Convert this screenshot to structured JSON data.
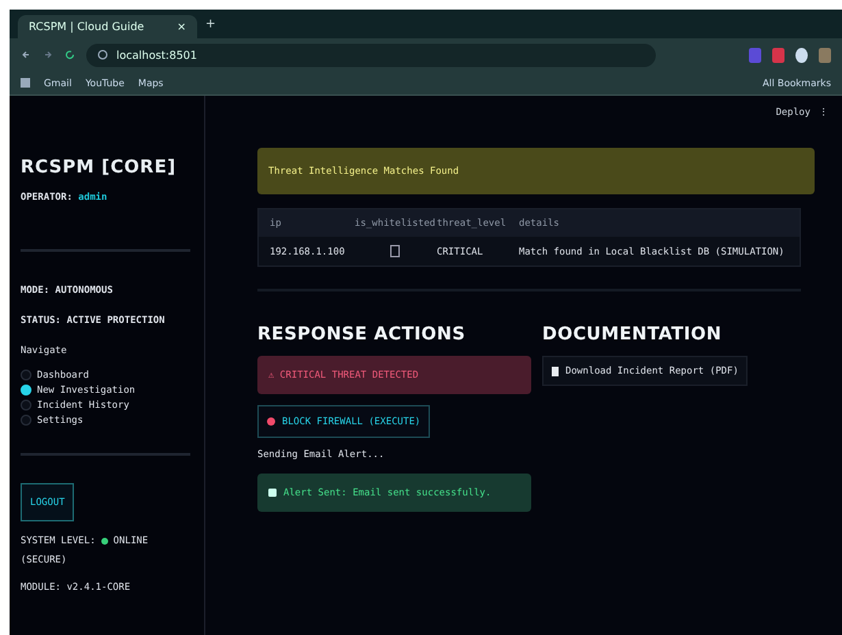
{
  "browser": {
    "tab_title": "RCSPM | Cloud Guide",
    "tab_close": "×",
    "new_tab": "+",
    "url": "localhost:8501",
    "bookmarks": [
      {
        "label": "Gmail"
      },
      {
        "label": "YouTube"
      },
      {
        "label": "Maps"
      }
    ],
    "all_bookmarks": "All Bookmarks"
  },
  "header": {
    "deploy": "Deploy",
    "menu": "⋮"
  },
  "sidebar": {
    "title": "RCSPM [CORE]",
    "operator_label": "OPERATOR:",
    "operator": "admin",
    "mode": "MODE: AUTONOMOUS",
    "status": "STATUS: ACTIVE PROTECTION",
    "nav_label": "Navigate",
    "nav_items": [
      {
        "label": "Dashboard",
        "selected": false
      },
      {
        "label": "New Investigation",
        "selected": true
      },
      {
        "label": "Incident History",
        "selected": false
      },
      {
        "label": "Settings",
        "selected": false
      }
    ],
    "logout": "LOGOUT",
    "system_label": "SYSTEM LEVEL:",
    "system_state": "ONLINE",
    "system_note": "(SECURE)",
    "module": "MODULE: v2.4.1-CORE"
  },
  "alert": "Threat Intelligence Matches Found",
  "table": {
    "columns": [
      "ip",
      "is_whitelisted",
      "threat_level",
      "details"
    ],
    "rows": [
      {
        "ip": "192.168.1.100",
        "is_whitelisted": false,
        "threat_level": "CRITICAL",
        "details": "Match found in Local Blacklist DB (SIMULATION)"
      }
    ]
  },
  "response": {
    "title": "RESPONSE ACTIONS",
    "threat": "⚠ CRITICAL THREAT DETECTED",
    "block": "BLOCK FIREWALL (EXECUTE)",
    "sending": "Sending Email Alert...",
    "sent": "Alert Sent: Email sent successfully."
  },
  "documentation": {
    "title": "DOCUMENTATION",
    "download": "Download Incident Report (PDF)"
  }
}
